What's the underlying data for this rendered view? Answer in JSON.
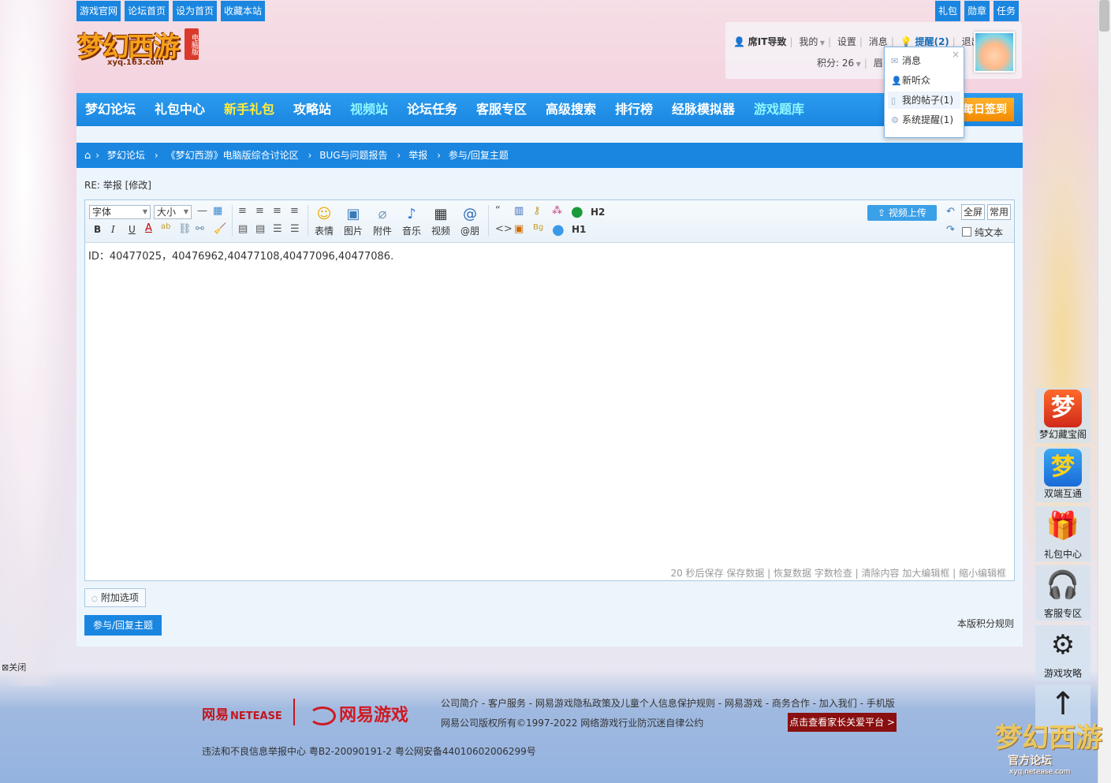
{
  "top_links": [
    "游戏官网",
    "论坛首页",
    "设为首页",
    "收藏本站"
  ],
  "top_right_links": [
    "礼包",
    "勋章",
    "任务"
  ],
  "logo": {
    "main": "梦幻西游",
    "badge": "电脑版",
    "url": "xyq.163.com"
  },
  "user": {
    "name": "席IT导致",
    "my": "我的",
    "settings": "设置",
    "messages": "消息",
    "reminder": "提醒(2)",
    "logout": "退出",
    "points": "积分: 26",
    "partial": "眉"
  },
  "dropdown": {
    "close": "×",
    "items": [
      "消息",
      "新听众",
      "我的帖子(1)",
      "系统提醒(1)"
    ]
  },
  "nav": {
    "items": [
      "梦幻论坛",
      "礼包中心",
      "新手礼包",
      "攻略站",
      "视频站",
      "论坛任务",
      "客服专区",
      "高级搜索",
      "排行榜",
      "经脉模拟器",
      "游戏题库"
    ],
    "checkin": "每日签到"
  },
  "breadcrumb": [
    "梦幻论坛",
    "《梦幻西游》电脑版综合讨论区",
    "BUG与问题报告",
    "举报",
    "参与/回复主题"
  ],
  "post_title": "RE: 举报 [修改]",
  "toolbar": {
    "font": "字体",
    "size": "大小",
    "bold": "B",
    "italic": "I",
    "underline": "U",
    "big_buttons": [
      "表情",
      "图片",
      "附件",
      "音乐",
      "视频",
      "@朋"
    ],
    "h2": "H2",
    "h1": "H1",
    "video_upload": "视频上传",
    "fullscreen": "全屏",
    "common": "常用",
    "plaintext": "纯文本"
  },
  "editor": {
    "content": "ID：40477025，40476962,40477108,40477096,40477086.",
    "status": "20 秒后保存 保存数据 | 恢复数据    字数检查 | 清除内容    加大编辑框 | 缩小编辑框"
  },
  "addon": "附加选项",
  "submit": "参与/回复主题",
  "rules": "本版积分规则",
  "close_link": "关闭",
  "float_items": [
    "梦幻藏宝阁",
    "双端互通",
    "礼包中心",
    "客服专区",
    "游戏攻略"
  ],
  "footer": {
    "logo1": "网易",
    "logo1_en": "NETEASE",
    "logo2": "网易游戏",
    "links": "公司简介 - 客户服务 - 网易游戏隐私政策及儿童个人信息保护规则 - 网易游戏 - 商务合作 - 加入我们 - 手机版",
    "copyright": "网易公司版权所有©1997-2022   网络游戏行业防沉迷自律公约",
    "parent_btn": "点击查看家长关爱平台 >",
    "legal": "违法和不良信息举报中心   粤B2-20090191-2 粤公网安备44010602006299号"
  },
  "corner_logo": {
    "main": "梦幻西游",
    "sub": "官方论坛",
    "url": "xyq.netease.com"
  }
}
